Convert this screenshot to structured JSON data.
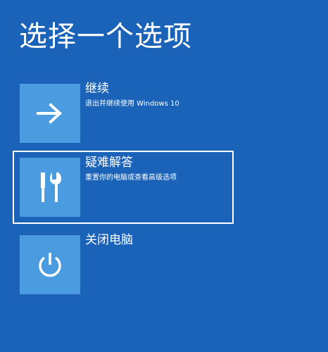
{
  "page": {
    "title": "选择一个选项"
  },
  "options": [
    {
      "title": "继续",
      "description": "退出并继续使用 Windows 10",
      "icon": "arrow-right-icon"
    },
    {
      "title": "疑难解答",
      "description": "重置你的电脑或查看高级选项",
      "icon": "tools-icon",
      "focused": true
    },
    {
      "title": "关闭电脑",
      "description": "",
      "icon": "power-icon"
    }
  ],
  "colors": {
    "background": "#1b63b8",
    "tile": "#4a9be0",
    "text": "#ffffff"
  }
}
